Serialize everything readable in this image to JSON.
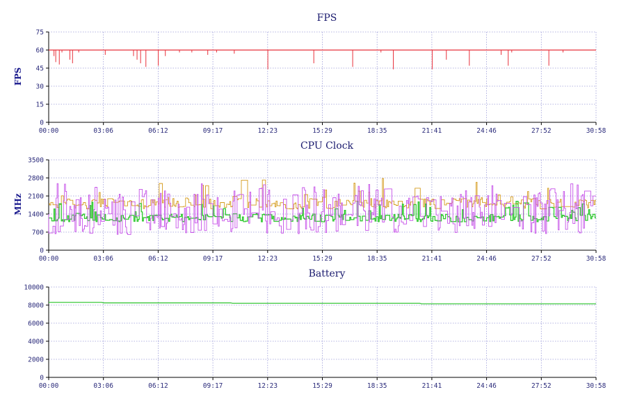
{
  "x_ticks": [
    "00:00",
    "03:06",
    "06:12",
    "09:17",
    "12:23",
    "15:29",
    "18:35",
    "21:41",
    "24:46",
    "27:52",
    "30:58"
  ],
  "colors": {
    "fps": "#e8303a",
    "cpu_orange": "#d49a1a",
    "cpu_green": "#2ec82e",
    "cpu_purple": "#c650e8",
    "battery": "#3cc83c",
    "grid": "#9a9ad8",
    "text": "#1a1a6e"
  },
  "chart_data": [
    {
      "id": "fps",
      "type": "line",
      "title": "FPS",
      "xlabel": "",
      "ylabel": "FPS",
      "ylim": [
        0,
        75
      ],
      "yticks": [
        0,
        15,
        30,
        45,
        60,
        75
      ],
      "grid": true,
      "series": [
        {
          "baseline": 60,
          "dips": [
            [
              0.3,
              55
            ],
            [
              0.4,
              50
            ],
            [
              0.6,
              48
            ],
            [
              0.75,
              58
            ],
            [
              1.2,
              52
            ],
            [
              1.35,
              49
            ],
            [
              1.7,
              58
            ],
            [
              3.2,
              56
            ],
            [
              4.8,
              55
            ],
            [
              5.0,
              52
            ],
            [
              5.2,
              49
            ],
            [
              5.5,
              46
            ],
            [
              6.2,
              47
            ],
            [
              6.6,
              55
            ],
            [
              7.4,
              58
            ],
            [
              8.1,
              58
            ],
            [
              9.0,
              56
            ],
            [
              9.5,
              58
            ],
            [
              10.5,
              57
            ],
            [
              12.4,
              44
            ],
            [
              15.0,
              49
            ],
            [
              17.2,
              46
            ],
            [
              18.8,
              58
            ],
            [
              19.5,
              44
            ],
            [
              21.7,
              44
            ],
            [
              22.5,
              52
            ],
            [
              23.8,
              47
            ],
            [
              25.6,
              56
            ],
            [
              26.0,
              47
            ],
            [
              26.2,
              58
            ],
            [
              28.3,
              47
            ],
            [
              29.1,
              58
            ]
          ]
        }
      ]
    },
    {
      "id": "cpu",
      "type": "line",
      "title": "CPU Clock",
      "xlabel": "",
      "ylabel": "MHz",
      "ylim": [
        0,
        3500
      ],
      "yticks": [
        0,
        700,
        1400,
        2100,
        2800,
        3500
      ],
      "grid": true,
      "series": [
        {
          "band_min": 1600,
          "band_max": 2000,
          "spike_max": 2800
        },
        {
          "band_min": 1100,
          "band_max": 1400,
          "spike_max": 1900
        },
        {
          "band_min": 600,
          "band_max": 2200,
          "spike_max": 2600
        }
      ]
    },
    {
      "id": "battery",
      "type": "line",
      "title": "Battery",
      "xlabel": "",
      "ylabel": "",
      "ylim": [
        0,
        10000
      ],
      "yticks": [
        0,
        2000,
        4000,
        6000,
        8000,
        10000
      ],
      "grid": true,
      "series": [
        {
          "x": [
            0,
            3.0,
            3.1,
            10.3,
            10.4,
            21.0,
            21.1,
            30.97
          ],
          "y": [
            8300,
            8300,
            8250,
            8250,
            8200,
            8200,
            8150,
            8150
          ]
        }
      ]
    }
  ]
}
